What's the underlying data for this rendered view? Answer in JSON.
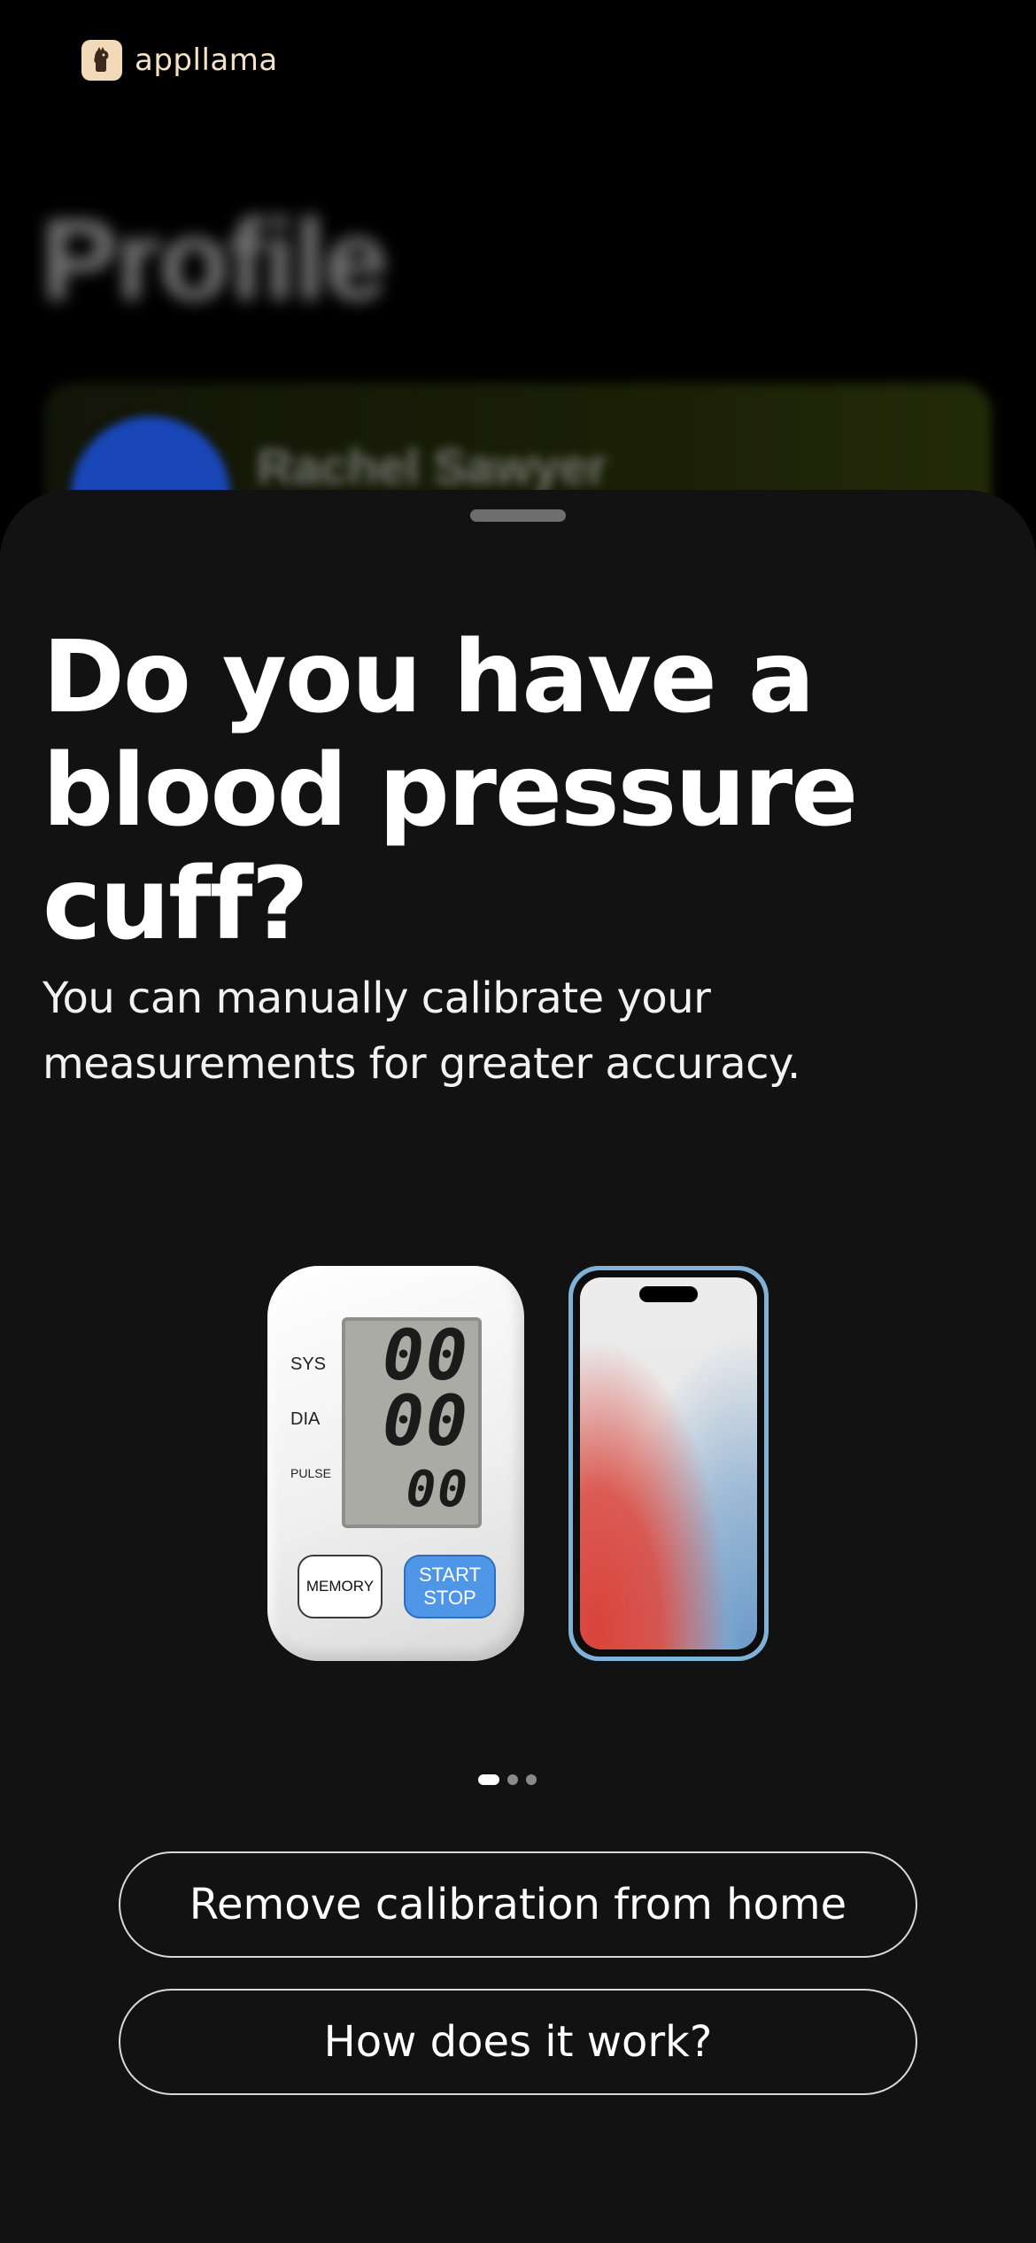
{
  "app": {
    "brand_name": "appllama",
    "brand_logo_icon": "llama-logo-icon"
  },
  "background_screen": {
    "title": "Profile",
    "profile_name": "Rachel Sawyer"
  },
  "sheet": {
    "headline": "Do you have a blood pressure cuff?",
    "subtext": "You can manually calibrate your measurements for greater accuracy.",
    "illustration": {
      "monitor": {
        "label_sys": "SYS",
        "label_dia": "DIA",
        "label_pulse": "PULSE",
        "display_sys": "00",
        "display_dia": "00",
        "display_pulse": "00",
        "button_memory": "MEMORY",
        "button_start": "START",
        "button_stop": "STOP"
      },
      "phone_icon": "smartphone-icon"
    },
    "pagination": {
      "total": 3,
      "active_index": 0
    },
    "buttons": {
      "remove_label": "Remove calibration from home",
      "how_label": "How does it work?"
    }
  },
  "colors": {
    "sheet_background": "#121212",
    "accent_blue": "#4f97e6",
    "brand_tan": "#f2d9b8"
  }
}
